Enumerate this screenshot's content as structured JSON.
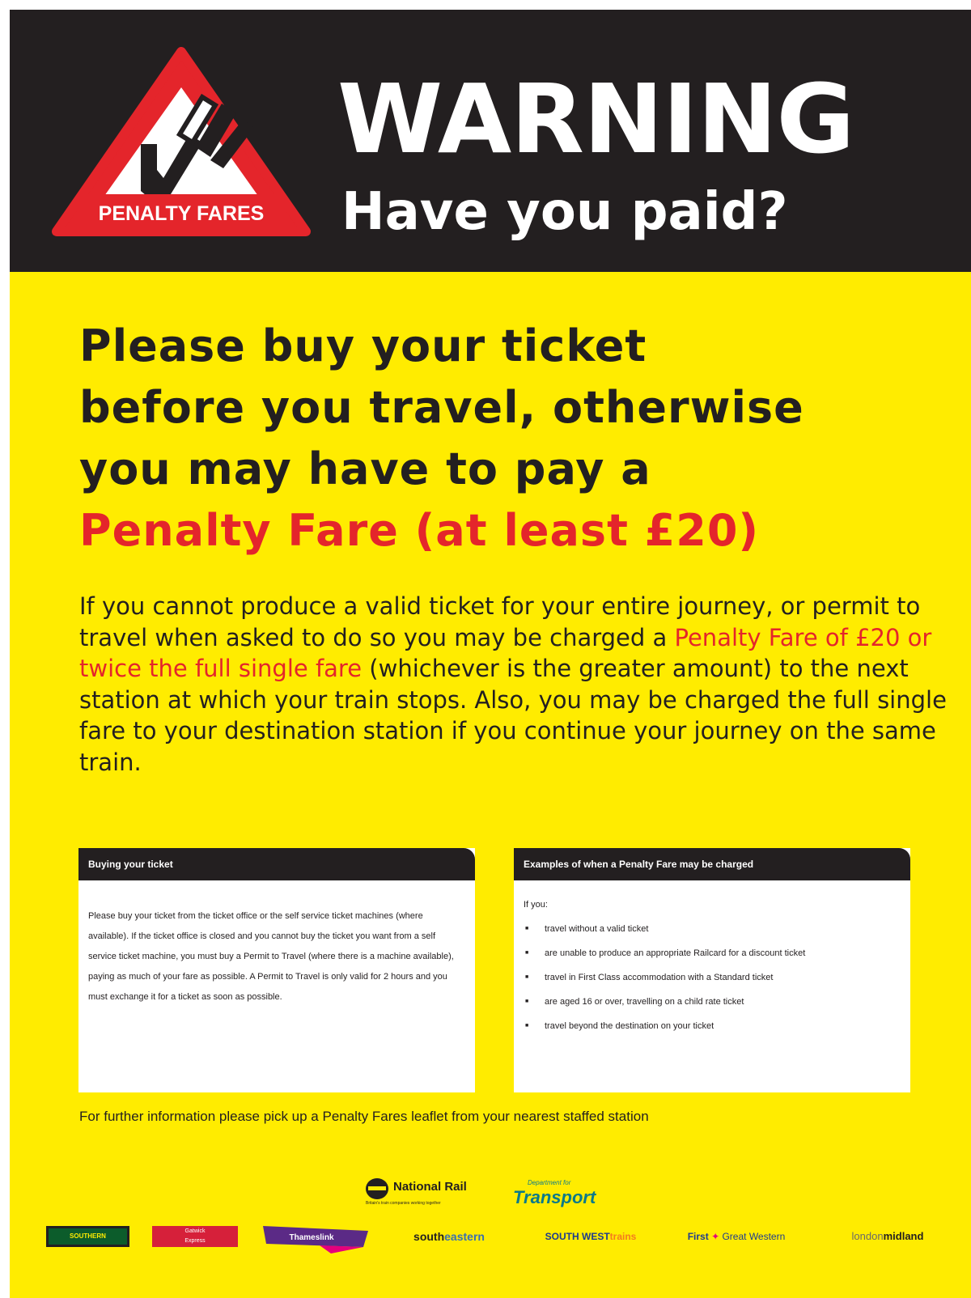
{
  "header": {
    "logo_label": "PENALTY FARES",
    "title": "WARNING",
    "subtitle": "Have you paid?"
  },
  "headline": {
    "lines": [
      "Please buy your ticket",
      "before you travel, otherwise",
      "you may have to pay a"
    ],
    "highlight": "Penalty Fare (at least £20)"
  },
  "body": {
    "part1": "If you cannot produce a valid ticket for your entire journey, or permit to travel when asked to do so you may be charged a ",
    "highlight": "Penalty Fare of £20 or twice the full single fare",
    "part2": " (whichever is the greater amount) to the next station at which your train stops. Also, you may be charged the full single fare to your destination station if you continue your journey on the same train."
  },
  "buying": {
    "heading": "Buying your ticket",
    "text": "Please buy your ticket from the ticket office or the self service ticket machines (where available). If the ticket office is closed and you cannot buy the ticket you want from a self service ticket machine, you must buy a Permit to Travel (where there is a machine available), paying as much of your fare as possible. A Permit to Travel is only valid for 2 hours and you must exchange it for a ticket as soon as possible."
  },
  "examples": {
    "heading": "Examples of when a Penalty Fare may be charged",
    "intro": "If you:",
    "items": [
      "travel without a valid ticket",
      "are unable to produce an appropriate Railcard for a discount ticket",
      "travel in First Class accommodation with a Standard ticket",
      "are aged 16 or over, travelling on a child rate ticket",
      "travel beyond the destination on your ticket"
    ]
  },
  "footer": {
    "note": "For further information please pick up a Penalty Fares leaflet from your nearest staffed station"
  },
  "logos": {
    "national_rail": "National Rail",
    "national_rail_sub": "Britain's train companies working together",
    "dft_small": "Department for",
    "dft_big": "Transport",
    "southern": "SOUTHERN",
    "gatwick_1": "Gatwick",
    "gatwick_2": "Express",
    "thameslink": "Thameslink",
    "southeastern_a": "south",
    "southeastern_b": "eastern",
    "swt_a": "SOUTH WEST",
    "swt_b": "trains",
    "fgw_a": "First",
    "fgw_b": "Great Western",
    "lm_a": "london",
    "lm_b": "midland"
  },
  "colors": {
    "header_bg": "#231f20",
    "poster_bg": "#ffec00",
    "accent_red": "#e4252b",
    "text_dark": "#231f20"
  }
}
